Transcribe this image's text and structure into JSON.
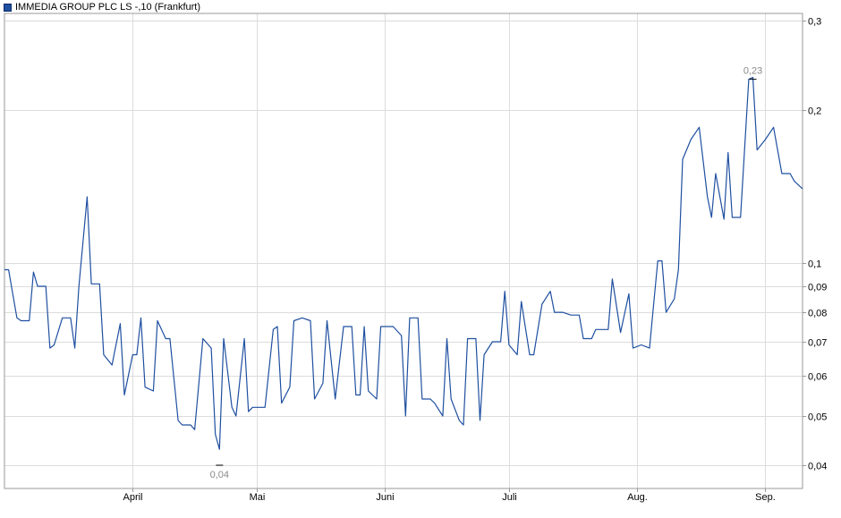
{
  "legend": {
    "label": "IMMEDIA GROUP PLC LS -,10 (Frankfurt)",
    "color": "#1f4fa0"
  },
  "chart_data": {
    "type": "line",
    "title": "",
    "xlabel": "",
    "ylabel": "",
    "y_scale": "log",
    "ylim": [
      0.036,
      0.31
    ],
    "grid": true,
    "legend_position": "top-left",
    "y_ticks": [
      {
        "value": 0.3,
        "label": "0,3"
      },
      {
        "value": 0.2,
        "label": "0,2"
      },
      {
        "value": 0.1,
        "label": "0,1"
      },
      {
        "value": 0.09,
        "label": "0,09"
      },
      {
        "value": 0.08,
        "label": "0,08"
      },
      {
        "value": 0.07,
        "label": "0,07"
      },
      {
        "value": 0.06,
        "label": "0,06"
      },
      {
        "value": 0.05,
        "label": "0,05"
      },
      {
        "value": 0.04,
        "label": "0,04"
      }
    ],
    "x_ticks": [
      {
        "index": 31,
        "label": "April"
      },
      {
        "index": 61,
        "label": "Mai"
      },
      {
        "index": 92,
        "label": "Juni"
      },
      {
        "index": 122,
        "label": "Juli"
      },
      {
        "index": 153,
        "label": "Aug."
      },
      {
        "index": 184,
        "label": "Sep."
      }
    ],
    "x_count": 194,
    "annotations": [
      {
        "index": 52,
        "value": 0.04,
        "label": "0,04",
        "position": "below"
      },
      {
        "index": 181,
        "value": 0.23,
        "label": "0,23",
        "position": "above"
      }
    ],
    "series": [
      {
        "color": "#1f4fa0",
        "points": [
          [
            0,
            0.097
          ],
          [
            1,
            0.097
          ],
          [
            3,
            0.078
          ],
          [
            4,
            0.077
          ],
          [
            6,
            0.077
          ],
          [
            7,
            0.096
          ],
          [
            8,
            0.09
          ],
          [
            10,
            0.09
          ],
          [
            11,
            0.068
          ],
          [
            12,
            0.069
          ],
          [
            14,
            0.078
          ],
          [
            16,
            0.078
          ],
          [
            17,
            0.068
          ],
          [
            18,
            0.09
          ],
          [
            20,
            0.135
          ],
          [
            21,
            0.091
          ],
          [
            23,
            0.091
          ],
          [
            24,
            0.066
          ],
          [
            26,
            0.063
          ],
          [
            28,
            0.076
          ],
          [
            29,
            0.055
          ],
          [
            31,
            0.066
          ],
          [
            32,
            0.066
          ],
          [
            33,
            0.078
          ],
          [
            34,
            0.057
          ],
          [
            36,
            0.056
          ],
          [
            37,
            0.077
          ],
          [
            39,
            0.071
          ],
          [
            40,
            0.071
          ],
          [
            42,
            0.049
          ],
          [
            43,
            0.048
          ],
          [
            45,
            0.048
          ],
          [
            46,
            0.047
          ],
          [
            48,
            0.071
          ],
          [
            50,
            0.068
          ],
          [
            51,
            0.046
          ],
          [
            52,
            0.043
          ],
          [
            53,
            0.071
          ],
          [
            55,
            0.052
          ],
          [
            56,
            0.05
          ],
          [
            58,
            0.071
          ],
          [
            59,
            0.051
          ],
          [
            60,
            0.052
          ],
          [
            61,
            0.052
          ],
          [
            63,
            0.052
          ],
          [
            65,
            0.074
          ],
          [
            66,
            0.075
          ],
          [
            67,
            0.053
          ],
          [
            69,
            0.057
          ],
          [
            70,
            0.077
          ],
          [
            72,
            0.078
          ],
          [
            74,
            0.077
          ],
          [
            75,
            0.054
          ],
          [
            77,
            0.058
          ],
          [
            78,
            0.077
          ],
          [
            80,
            0.054
          ],
          [
            82,
            0.075
          ],
          [
            84,
            0.075
          ],
          [
            85,
            0.055
          ],
          [
            86,
            0.055
          ],
          [
            87,
            0.075
          ],
          [
            88,
            0.056
          ],
          [
            90,
            0.054
          ],
          [
            91,
            0.075
          ],
          [
            93,
            0.075
          ],
          [
            94,
            0.075
          ],
          [
            96,
            0.072
          ],
          [
            97,
            0.05
          ],
          [
            98,
            0.078
          ],
          [
            100,
            0.078
          ],
          [
            101,
            0.054
          ],
          [
            103,
            0.054
          ],
          [
            104,
            0.053
          ],
          [
            106,
            0.05
          ],
          [
            107,
            0.071
          ],
          [
            108,
            0.054
          ],
          [
            110,
            0.049
          ],
          [
            111,
            0.048
          ],
          [
            112,
            0.071
          ],
          [
            114,
            0.071
          ],
          [
            115,
            0.049
          ],
          [
            116,
            0.066
          ],
          [
            118,
            0.07
          ],
          [
            120,
            0.07
          ],
          [
            121,
            0.088
          ],
          [
            122,
            0.069
          ],
          [
            124,
            0.066
          ],
          [
            125,
            0.084
          ],
          [
            127,
            0.066
          ],
          [
            128,
            0.066
          ],
          [
            130,
            0.083
          ],
          [
            132,
            0.088
          ],
          [
            133,
            0.08
          ],
          [
            135,
            0.08
          ],
          [
            137,
            0.079
          ],
          [
            138,
            0.079
          ],
          [
            139,
            0.079
          ],
          [
            140,
            0.071
          ],
          [
            142,
            0.071
          ],
          [
            143,
            0.074
          ],
          [
            145,
            0.074
          ],
          [
            146,
            0.074
          ],
          [
            147,
            0.093
          ],
          [
            149,
            0.073
          ],
          [
            151,
            0.087
          ],
          [
            152,
            0.068
          ],
          [
            154,
            0.069
          ],
          [
            156,
            0.068
          ],
          [
            157,
            0.083
          ],
          [
            158,
            0.101
          ],
          [
            159,
            0.101
          ],
          [
            160,
            0.08
          ],
          [
            162,
            0.085
          ],
          [
            163,
            0.097
          ],
          [
            164,
            0.16
          ],
          [
            166,
            0.175
          ],
          [
            168,
            0.185
          ],
          [
            170,
            0.135
          ],
          [
            171,
            0.123
          ],
          [
            172,
            0.15
          ],
          [
            174,
            0.122
          ],
          [
            175,
            0.165
          ],
          [
            176,
            0.123
          ],
          [
            178,
            0.123
          ],
          [
            180,
            0.23
          ],
          [
            181,
            0.232
          ],
          [
            182,
            0.167
          ],
          [
            184,
            0.175
          ],
          [
            186,
            0.185
          ],
          [
            188,
            0.15
          ],
          [
            190,
            0.15
          ],
          [
            191,
            0.145
          ],
          [
            193,
            0.14
          ]
        ]
      }
    ]
  }
}
